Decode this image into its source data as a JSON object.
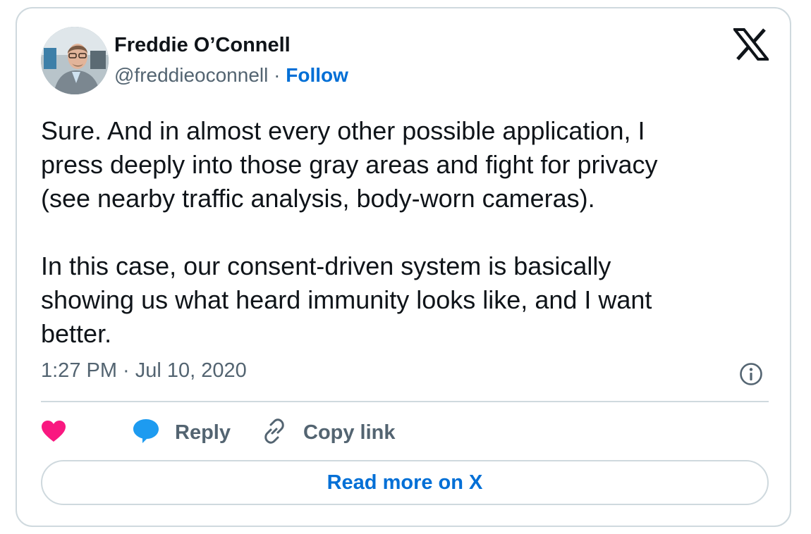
{
  "author": {
    "name": "Freddie O’Connell",
    "handle": "@freddieoconnell",
    "separator": "·",
    "follow_label": "Follow"
  },
  "tweet": {
    "paragraphs": [
      "Sure. And in almost every other possible application, I\npress deeply into those gray areas and fight for privacy\n(see nearby traffic analysis, body-worn cameras).",
      "In this case, our consent-driven system is basically\nshowing us what heard immunity looks like, and I want\nbetter."
    ],
    "timestamp": "1:27 PM · Jul 10, 2020"
  },
  "actions": {
    "reply_label": "Reply",
    "copy_link_label": "Copy link"
  },
  "read_more_label": "Read more on X",
  "icons": {
    "logo": "x-logo-icon",
    "info": "info-icon",
    "like": "heart-icon",
    "reply": "speech-bubble-icon",
    "copy": "link-icon"
  },
  "colors": {
    "like": "#f91880",
    "reply": "#1d9bf0",
    "link": "#006fd6",
    "text": "#0f1419",
    "secondary": "#536471",
    "border": "#cfd9de"
  }
}
